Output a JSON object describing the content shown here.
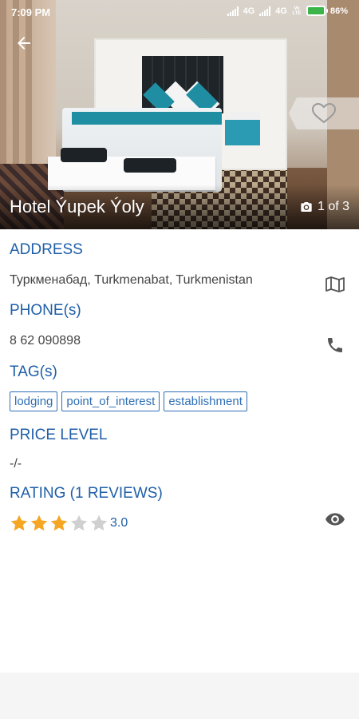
{
  "status_bar": {
    "time": "7:09 PM",
    "network_1": "4G",
    "network_2": "4G",
    "volte": "Vo LTE",
    "battery": "86%"
  },
  "header": {
    "back_icon": "arrow-left-icon",
    "favorite_icon": "heart-icon",
    "hotel_name": "Hotel Ýupek Ýoly",
    "photo_counter": "1 of 3",
    "camera_icon": "camera-icon"
  },
  "details": {
    "address": {
      "label": "ADDRESS",
      "value": "Туркменабад, Turkmenabat, Turkmenistan",
      "icon": "map-icon"
    },
    "phone": {
      "label": "PHONE(s)",
      "value": "8 62 090898",
      "icon": "phone-icon"
    },
    "tags": {
      "label": "TAG(s)",
      "items": [
        "lodging",
        "point_of_interest",
        "establishment"
      ]
    },
    "price": {
      "label": "PRICE LEVEL",
      "value": "-/-"
    },
    "rating": {
      "label": "RATING (1 REVIEWS)",
      "value": "3.0",
      "stars_filled": 3,
      "stars_total": 5,
      "icon": "eye-icon"
    }
  },
  "colors": {
    "accent": "#1f5fa8",
    "star_filled": "#f5a623",
    "star_empty": "#d0d0d0"
  }
}
